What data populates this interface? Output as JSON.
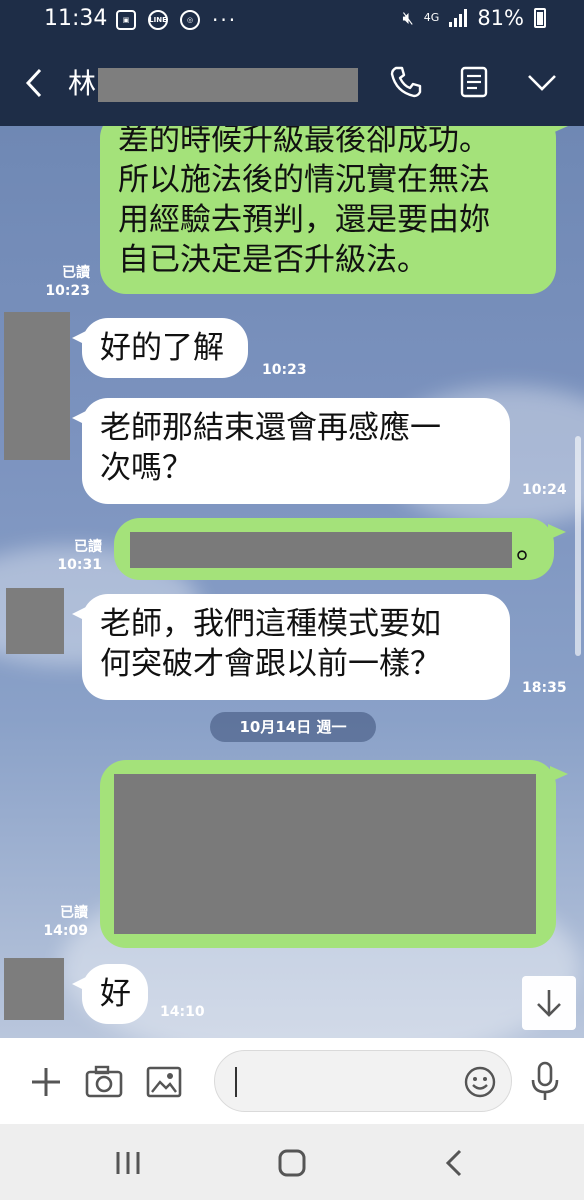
{
  "status_bar": {
    "time": "11:34",
    "network": "4G",
    "battery": "81%"
  },
  "header": {
    "contact_name": "林",
    "icons": [
      "back-chevron-icon",
      "phone-icon",
      "notes-icon",
      "chevron-down-icon"
    ]
  },
  "messages": [
    {
      "id": "m1",
      "direction": "outgoing",
      "lines": [
        "差的時候升級最後卻成功。",
        "所以施法後的情況實在無法",
        "用經驗去預判，還是要由妳",
        "自已決定是否升級法。"
      ],
      "read_label": "已讀",
      "time": "10:23"
    },
    {
      "id": "m2",
      "direction": "incoming",
      "lines": [
        "好的了解"
      ],
      "time": "10:23"
    },
    {
      "id": "m3",
      "direction": "incoming",
      "lines": [
        "老師那結束還會再感應一",
        "次嗎？"
      ],
      "time": "10:24"
    },
    {
      "id": "m4",
      "direction": "outgoing",
      "lines": [
        "。"
      ],
      "redacted": true,
      "read_label": "已讀",
      "time": "10:31"
    },
    {
      "id": "m5",
      "direction": "incoming",
      "lines": [
        "老師，我們這種模式要如",
        "何突破才會跟以前一樣？"
      ],
      "time": "18:35"
    },
    {
      "id": "m6",
      "direction": "outgoing",
      "redacted": true,
      "read_label": "已讀",
      "time": "14:09"
    },
    {
      "id": "m7",
      "direction": "incoming",
      "lines": [
        "好"
      ],
      "time": "14:10"
    }
  ],
  "date_separator": "10月14日 週一",
  "input": {
    "placeholder": "",
    "value": ""
  },
  "colors": {
    "header_bg": "#1e2d47",
    "outgoing_bubble": "#a4e27a",
    "incoming_bubble": "#ffffff",
    "redaction": "#7a7a7a"
  }
}
